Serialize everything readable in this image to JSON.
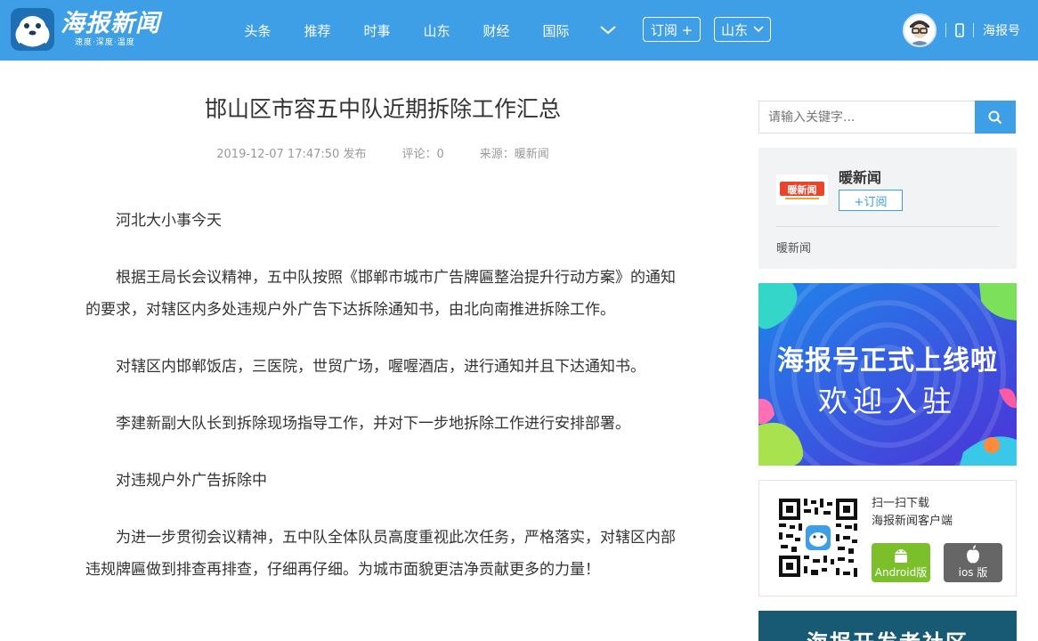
{
  "header": {
    "logo_title": "海报新闻",
    "logo_sub": "速度·深度·温度",
    "nav": [
      "头条",
      "推荐",
      "时事",
      "山东",
      "财经",
      "国际"
    ],
    "subscribe_label": "订阅 +",
    "region_label": "山东",
    "haibao_label": "海报号",
    "accent": "#3e9ee6"
  },
  "article": {
    "title": "邯山区市容五中队近期拆除工作汇总",
    "date": "2019-12-07 17:47:50 发布",
    "comments": "评论：0",
    "source": "来源：暖新闻",
    "paragraphs": [
      "河北大小事今天",
      "根据王局长会议精神，五中队按照《邯郸市城市广告牌匾整治提升行动方案》的通知的要求，对辖区内多处违规户外广告下达拆除通知书，由北向南推进拆除工作。",
      "对辖区内邯郸饭店，三医院，世贸广场，喔喔酒店，进行通知并且下达通知书。",
      "李建新副大队长到拆除现场指导工作，并对下一步地拆除工作进行安排部署。",
      "对违规户外广告拆除中",
      "为进一步贯彻会议精神，五中队全体队员高度重视此次任务，严格落实，对辖区内部违规牌匾做到排查再排查，仔细再仔细。为城市面貌更洁净贡献更多的力量！"
    ]
  },
  "sidebar": {
    "search_placeholder": "请输入关键字...",
    "source_card": {
      "logo_text": "暖新闻",
      "name": "暖新闻",
      "subscribe": "+订阅",
      "desc": "暖新闻"
    },
    "banner": {
      "line1": "海报号正式上线啦",
      "line2": "欢迎入驻"
    },
    "app": {
      "line1": "扫一扫下载",
      "line2": "海报新闻客户端",
      "android": "Android版",
      "ios": "ios 版"
    },
    "dev_banner": "海报开发者社区"
  }
}
